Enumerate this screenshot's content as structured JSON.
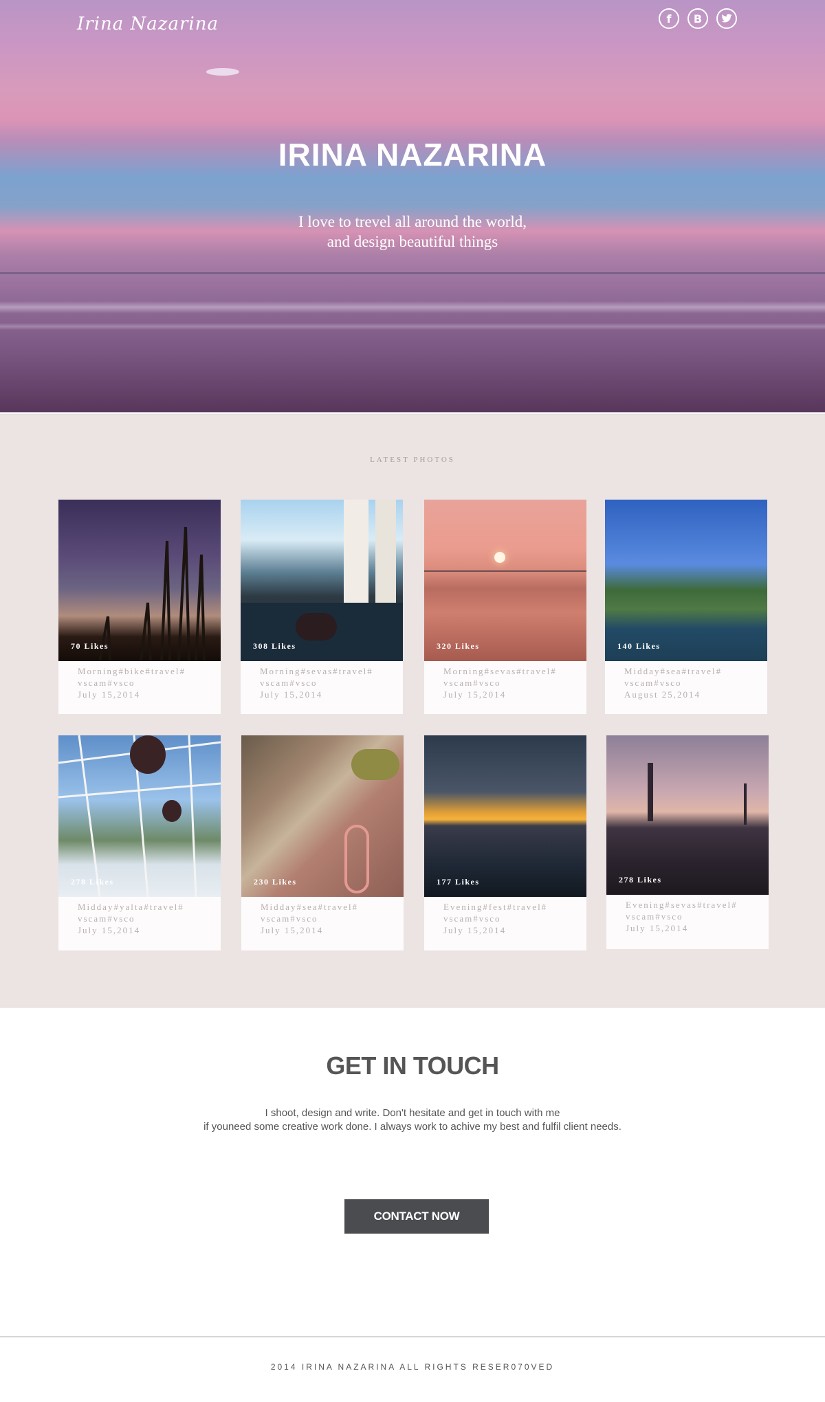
{
  "header": {
    "logo": "Irina Nazarina",
    "social": [
      {
        "icon": "facebook-icon",
        "glyph": "f"
      },
      {
        "icon": "behance-icon",
        "glyph": "B"
      },
      {
        "icon": "twitter-icon",
        "glyph": "🐦"
      }
    ]
  },
  "hero": {
    "title": "IRINA NAZARINA",
    "subtitle_line1": "I love to trevel all around the world,",
    "subtitle_line2": "and design beautiful things"
  },
  "photos": {
    "label": "LATEST PHOTOS",
    "cards": [
      {
        "likes": "70 Likes",
        "tags1": "Morning#bike#travel#",
        "tags2": "vscam#vsco",
        "date": "July 15,2014"
      },
      {
        "likes": "308 Likes",
        "tags1": "Morning#sevas#travel#",
        "tags2": "vscam#vsco",
        "date": "July 15,2014"
      },
      {
        "likes": "320 Likes",
        "tags1": "Morning#sevas#travel#",
        "tags2": "vscam#vsco",
        "date": "July 15,2014"
      },
      {
        "likes": "140 Likes",
        "tags1": "Midday#sea#travel#",
        "tags2": "vscam#vsco",
        "date": "August 25,2014"
      },
      {
        "likes": "278 Likes",
        "tags1": "Midday#yalta#travel#",
        "tags2": "vscam#vsco",
        "date": "July 15,2014"
      },
      {
        "likes": "230 Likes",
        "tags1": "Midday#sea#travel#",
        "tags2": "vscam#vsco",
        "date": "July 15,2014"
      },
      {
        "likes": "177 Likes",
        "tags1": "Evening#fest#travel#",
        "tags2": "vscam#vsco",
        "date": "July 15,2014"
      },
      {
        "likes": "278 Likes",
        "tags1": "Evening#sevas#travel#",
        "tags2": "vscam#vsco",
        "date": "July 15,2014"
      }
    ]
  },
  "contact": {
    "title": "GET IN TOUCH",
    "text_line1": "I shoot, design and write. Don't hesitate and get in touch with me",
    "text_line2": "if youneed some creative work done. I always work to achive my best and fulfil client needs.",
    "button": "CONTACT NOW"
  },
  "footer": {
    "text": "2014 IRINA NAZARINA ALL RIGHTS RESER070VED"
  }
}
